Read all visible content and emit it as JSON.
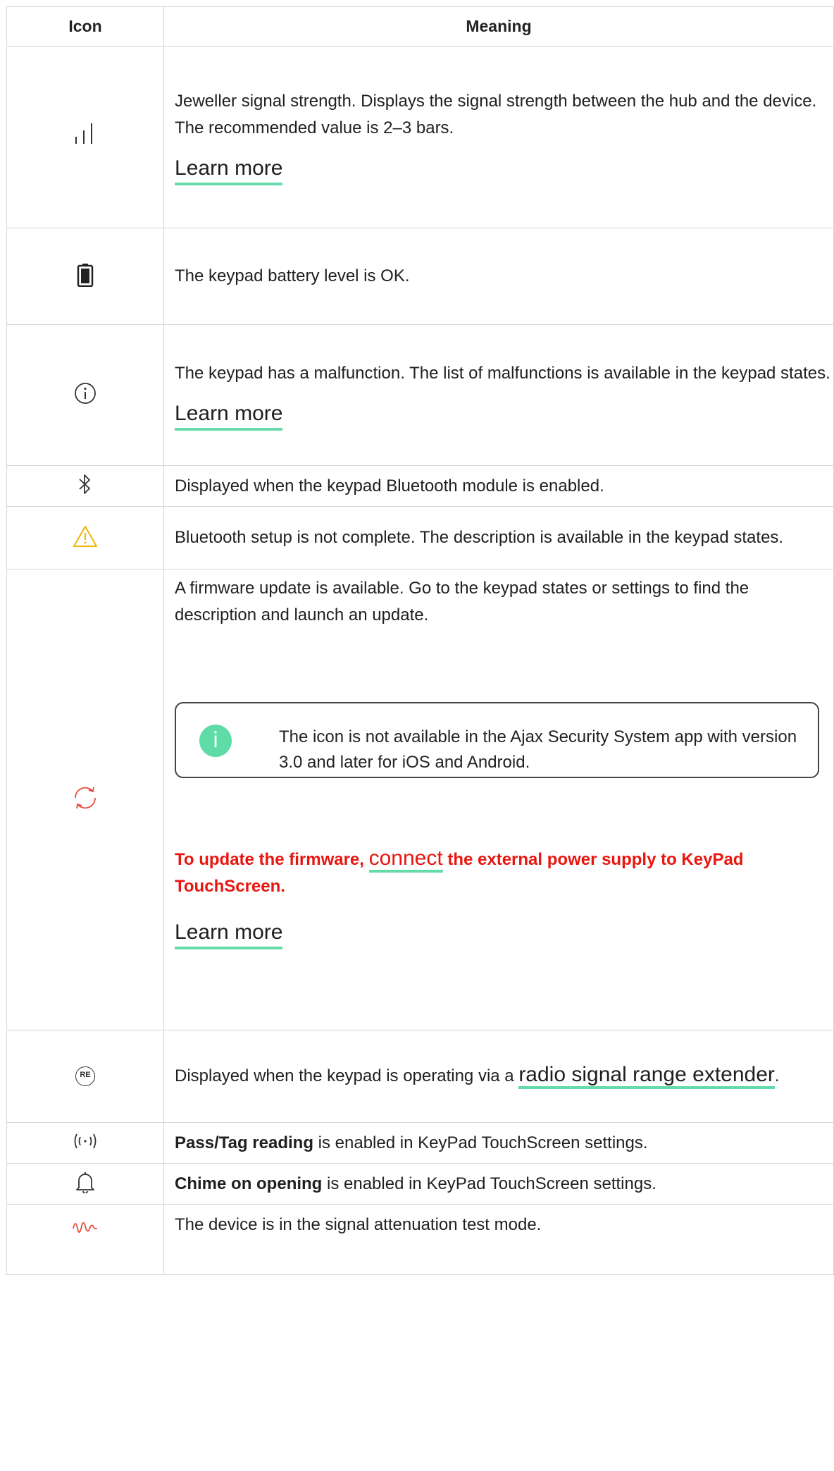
{
  "header": {
    "icon": "Icon",
    "meaning": "Meaning"
  },
  "rows": [
    {
      "icon": "signal-strength-icon",
      "text": "Jeweller signal strength. Displays the signal strength between the hub and the device. The recommended value is 2–3 bars.",
      "link": "Learn more"
    },
    {
      "icon": "battery-icon",
      "text": "The keypad battery level is OK."
    },
    {
      "icon": "info-circle-icon",
      "text": "The keypad has a malfunction. The list of malfunctions is available in the keypad states.",
      "link": "Learn more"
    },
    {
      "icon": "bluetooth-icon",
      "text": "Displayed when the keypad Bluetooth module is enabled."
    },
    {
      "icon": "warning-triangle-icon",
      "text": "Bluetooth setup is not complete. The description is available in the keypad states."
    },
    {
      "icon": "firmware-update-icon",
      "text": "A firmware update is available. Go to the keypad states or settings to find the description and launch an update.",
      "note_badge": "i",
      "note": "The icon is not available in the Ajax Security System app with version 3.0 and later for iOS and Android.",
      "warning_before": "To update the firmware, ",
      "warning_link": "connect",
      "warning_after": " the external power supply to KeyPad TouchScreen.",
      "link": "Learn more"
    },
    {
      "icon": "range-extender-icon",
      "icon_label": "RE",
      "text_before": "Displayed when the keypad is operating via a ",
      "text_link": "radio signal range extender",
      "text_after": "."
    },
    {
      "icon": "pass-tag-reading-icon",
      "bold": "Pass/Tag reading",
      "text": " is enabled in KeyPad TouchScreen settings."
    },
    {
      "icon": "bell-icon",
      "bold": "Chime on opening",
      "text": " is enabled in KeyPad TouchScreen settings."
    },
    {
      "icon": "attenuation-test-icon",
      "text": "The device is in the signal attenuation test mode."
    }
  ],
  "colors": {
    "accent_underline": "#66dbaa",
    "warning_red": "#e8160f",
    "warning_icon": "#f2b400",
    "update_icon": "#e84b3c"
  }
}
